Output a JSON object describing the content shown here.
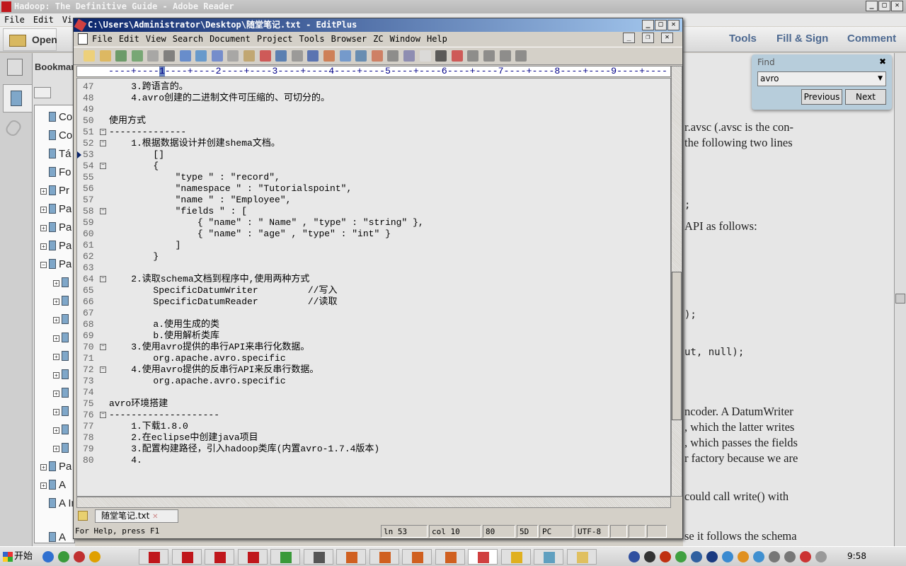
{
  "reader": {
    "title": "Hadoop: The Definitive Guide - Adobe Reader",
    "menu": [
      "File",
      "Edit",
      "View"
    ],
    "open_label": "Open",
    "tabs": [
      "Tools",
      "Fill & Sign",
      "Comment"
    ],
    "bookmarks_label": "Bookmar",
    "bookmarks": [
      "Co",
      "Co",
      "Tá",
      "Fo",
      "Pr",
      "Pa",
      "Pa",
      "Pa",
      "Pa",
      "",
      "",
      "",
      "",
      "",
      "",
      "",
      "",
      "",
      "",
      "Pa",
      "A",
      "A In",
      "A"
    ],
    "find": {
      "title": "Find",
      "value": "avro",
      "previous": "Previous",
      "next": "Next"
    },
    "doc_lines": [
      "r.avsc (.avsc is the con-",
      "the following two lines",
      ";",
      "API as follows:",
      ");",
      "ut, null);",
      "ncoder. A DatumWriter",
      ", which the latter writes",
      ", which passes the fields",
      "r factory because we are",
      "could call write() with",
      "se it follows the schema"
    ]
  },
  "editplus": {
    "title": "C:\\Users\\Administrator\\Desktop\\随堂笔记.txt - EditPlus",
    "menu": [
      "File",
      "Edit",
      "View",
      "Search",
      "Document",
      "Project",
      "Tools",
      "Browser",
      "ZC",
      "Window",
      "Help"
    ],
    "ruler": "----+----1----+----2----+----3----+----4----+----5----+----6----+----7----+----8----+----9----+----",
    "current_line": 53,
    "lines": [
      {
        "n": "47",
        "t": "    3.跨语言的。"
      },
      {
        "n": "48",
        "t": "    4.avro创建的二进制文件可压缩的、可切分的。"
      },
      {
        "n": "49",
        "t": ""
      },
      {
        "n": "50",
        "t": "使用方式"
      },
      {
        "n": "51",
        "t": "--------------",
        "fold": true
      },
      {
        "n": "52",
        "t": "    1.根据数据设计并创建shema文档。",
        "fold": true
      },
      {
        "n": "53",
        "t": "        []"
      },
      {
        "n": "54",
        "t": "        {",
        "fold": true
      },
      {
        "n": "55",
        "t": "            \"type \" : \"record\","
      },
      {
        "n": "56",
        "t": "            \"namespace \" : \"Tutorialspoint\","
      },
      {
        "n": "57",
        "t": "            \"name \" : \"Employee\","
      },
      {
        "n": "58",
        "t": "            \"fields \" : [",
        "fold": true
      },
      {
        "n": "59",
        "t": "                { \"name\" : \" Name\" , \"type\" : \"string\" },"
      },
      {
        "n": "60",
        "t": "                { \"name\" : \"age\" , \"type\" : \"int\" }"
      },
      {
        "n": "61",
        "t": "            ]"
      },
      {
        "n": "62",
        "t": "        }"
      },
      {
        "n": "63",
        "t": ""
      },
      {
        "n": "64",
        "t": "    2.读取schema文档到程序中,使用两种方式",
        "fold": true
      },
      {
        "n": "65",
        "t": "        SpecificDatumWriter         //写入"
      },
      {
        "n": "66",
        "t": "        SpecificDatumReader         //读取"
      },
      {
        "n": "67",
        "t": ""
      },
      {
        "n": "68",
        "t": "        a.使用生成的类"
      },
      {
        "n": "69",
        "t": "        b.使用解析类库"
      },
      {
        "n": "70",
        "t": "    3.使用avro提供的串行API来串行化数据。",
        "fold": true
      },
      {
        "n": "71",
        "t": "        org.apache.avro.specific"
      },
      {
        "n": "72",
        "t": "    4.使用avro提供的反串行API来反串行数据。",
        "fold": true
      },
      {
        "n": "73",
        "t": "        org.apache.avro.specific"
      },
      {
        "n": "74",
        "t": ""
      },
      {
        "n": "75",
        "t": "avro环境搭建"
      },
      {
        "n": "76",
        "t": "--------------------",
        "fold": true
      },
      {
        "n": "77",
        "t": "    1.下载1.8.0"
      },
      {
        "n": "78",
        "t": "    2.在eclipse中创建java项目"
      },
      {
        "n": "79",
        "t": "    3.配置构建路径，引入hadoop类库(内置avro-1.7.4版本)"
      },
      {
        "n": "80",
        "t": "    4."
      }
    ],
    "file_tab": "随堂笔记.txt",
    "status": {
      "help": "For Help, press F1",
      "ln": "ln 53",
      "col": "col 10",
      "width": "80",
      "mode": "5D",
      "eol": "PC",
      "encoding": "UTF-8"
    }
  },
  "taskbar": {
    "start": "开始",
    "clock": "9:58"
  },
  "colors": {
    "ep_title": "#0a246a",
    "reader_tab": "#4c6890",
    "find_bg": "#b7cddb"
  }
}
